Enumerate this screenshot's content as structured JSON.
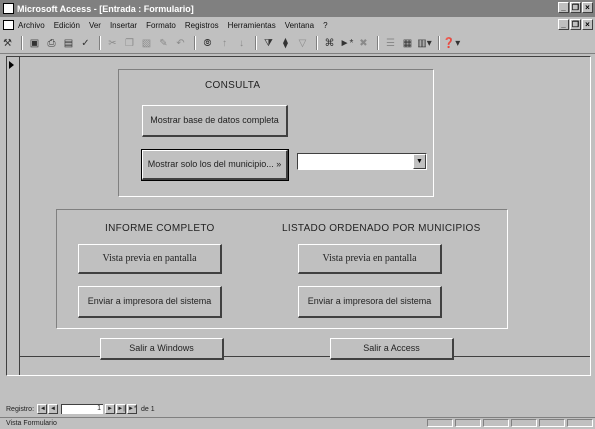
{
  "window": {
    "title": "Microsoft Access - [Entrada : Formulario]",
    "minimize": "_",
    "restore": "❐",
    "close": "×"
  },
  "menu": {
    "items": [
      "Archivo",
      "Edición",
      "Ver",
      "Insertar",
      "Formato",
      "Registros",
      "Herramientas",
      "Ventana",
      "?"
    ]
  },
  "toolbar": {
    "icons": [
      "design-view-icon",
      "save-icon",
      "print-icon",
      "print-preview-icon",
      "spelling-icon",
      "cut-icon",
      "copy-icon",
      "paste-icon",
      "format-painter-icon",
      "undo-icon",
      "insert-hyperlink-icon",
      "sort-ascending-icon",
      "sort-descending-icon",
      "filter-by-selection-icon",
      "filter-by-form-icon",
      "apply-filter-icon",
      "find-icon",
      "new-record-icon",
      "delete-record-icon",
      "properties-icon",
      "database-window-icon",
      "new-object-icon",
      "office-assistant-icon"
    ]
  },
  "consulta": {
    "heading": "CONSULTA",
    "show_all_label": "Mostrar base de datos completa",
    "show_municipality_label": "Mostrar solo los del municipio... »",
    "municipio_value": ""
  },
  "informe": {
    "heading": "INFORME COMPLETO",
    "preview_label": "Vista previa en pantalla",
    "print_label": "Enviar a impresora del sistema"
  },
  "listado": {
    "heading": "LISTADO ORDENADO POR MUNICIPIOS",
    "preview_label": "Vista previa en pantalla",
    "print_label": "Enviar a impresora del sistema"
  },
  "footer_buttons": {
    "exit_windows_label": "Salir a Windows",
    "exit_access_label": "Salir a Access"
  },
  "record_nav": {
    "label": "Registro:",
    "first": "|◄",
    "prev": "◄",
    "current": "1",
    "next": "►",
    "last": "►|",
    "new": "►*",
    "of_label": "de 1"
  },
  "status": {
    "text": "Vista Formulario"
  }
}
